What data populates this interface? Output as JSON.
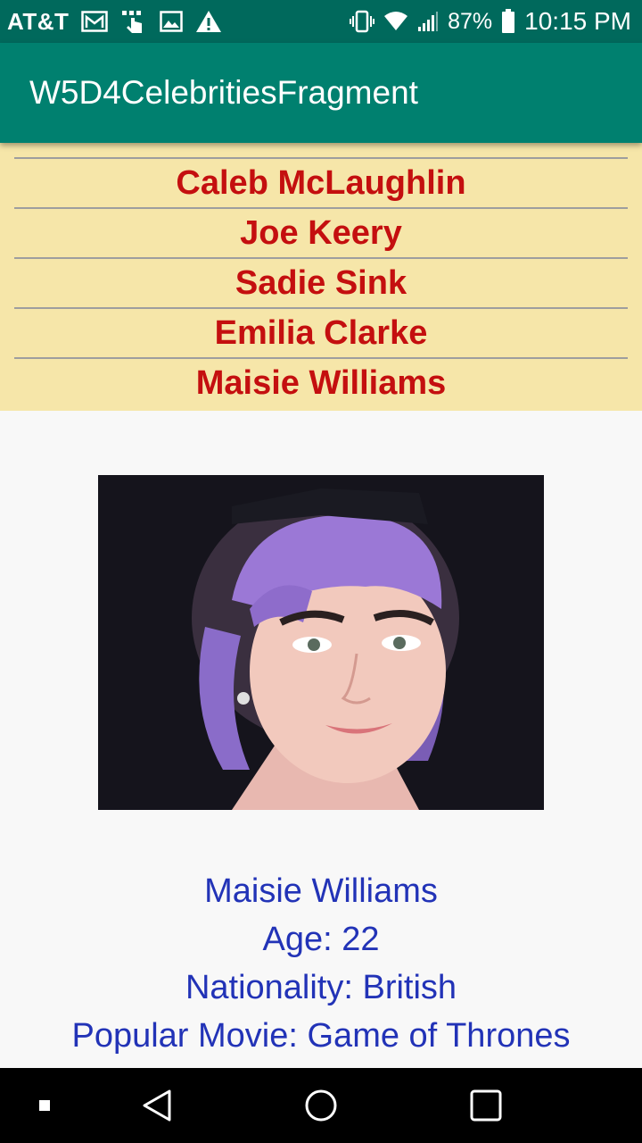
{
  "status_bar": {
    "carrier": "AT&T",
    "battery": "87%",
    "time": "10:15 PM",
    "left_icons": [
      "gmail-icon",
      "hand-touch-icon",
      "image-icon",
      "warning-icon"
    ],
    "right_icons": [
      "vibrate-icon",
      "wifi-icon",
      "signal-icon",
      "battery-icon"
    ]
  },
  "app_bar": {
    "title": "W5D4CelebritiesFragment",
    "color": "#00806f"
  },
  "celebrities": [
    {
      "name": "Caleb McLaughlin"
    },
    {
      "name": "Joe Keery"
    },
    {
      "name": "Sadie Sink"
    },
    {
      "name": "Emilia Clarke"
    },
    {
      "name": "Maisie Williams"
    }
  ],
  "details": {
    "name": "Maisie Williams",
    "age": "Age: 22",
    "nationality": "Nationality: British",
    "movie": "Popular Movie: Game of Thrones"
  },
  "colors": {
    "status_bar": "#00695c",
    "list_background": "#f6e6a9",
    "list_text": "#c40f0f",
    "detail_text": "#2233b7"
  },
  "nav_bar": {
    "buttons": [
      "recents-dot-icon",
      "back-icon",
      "home-icon",
      "overview-icon"
    ]
  }
}
